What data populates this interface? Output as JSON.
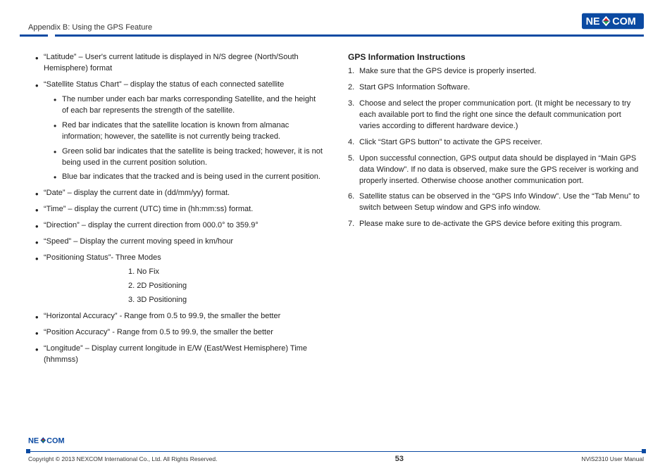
{
  "header": {
    "breadcrumb": "Appendix B: Using the GPS Feature",
    "brand": "NEXCOM"
  },
  "left": {
    "items": [
      {
        "text": "“Latitude” – User's current latitude is displayed in N/S degree (North/South Hemisphere) format"
      },
      {
        "text": "“Satellite Status Chart” – display the status of each connected satellite",
        "sub": [
          "The number under each bar marks corresponding Satellite, and the height of each bar represents the strength of the satellite.",
          "Red bar indicates that the satellite location is known from almanac information; however, the satellite is not currently being tracked.",
          "Green solid bar indicates that the satellite is being tracked; however, it is not being used in the current position solution.",
          "Blue bar indicates that the tracked and is being used in the current position."
        ]
      },
      {
        "text": "“Date” – display the current date in (dd/mm/yy) format."
      },
      {
        "text": "“Time” – display the current (UTC) time in (hh:mm:ss) format."
      },
      {
        "text": "“Direction” – display the current direction from 000.0° to 359.9°"
      },
      {
        "text": "“Speed” – Display the current moving speed in km/hour"
      },
      {
        "text": "“Positioning Status”- Three Modes",
        "modes": [
          "1. No Fix",
          "2. 2D Positioning",
          "3. 3D Positioning"
        ]
      },
      {
        "text": "“Horizontal Accuracy” - Range from 0.5 to 99.9, the smaller the better"
      },
      {
        "text": "“Position Accuracy” - Range from 0.5 to 99.9, the smaller the better"
      },
      {
        "text": "“Longitude” – Display current longitude in E/W (East/West Hemisphere) Time (hhmmss)"
      }
    ]
  },
  "right": {
    "heading": "GPS Information Instructions",
    "steps": [
      "Make sure that the GPS device is properly inserted.",
      "Start GPS Information Software.",
      "Choose and select the proper communication port. (It might be necessary to try each available port to find the right one since the default communication port varies according to different hardware device.)",
      "Click “Start GPS button” to activate the GPS receiver.",
      "Upon successful connection, GPS output data should be displayed in “Main GPS data Window”. If no data is observed, make sure the GPS receiver is working and properly inserted. Otherwise choose another communication port.",
      "Satellite status can be observed in the “GPS Info Window”. Use the “Tab Menu” to switch between Setup window and GPS info window.",
      "Please make sure to de-activate the GPS device before exiting this program."
    ]
  },
  "footer": {
    "copyright": "Copyright © 2013 NEXCOM International Co., Ltd. All Rights Reserved.",
    "page": "53",
    "manual": "NViS2310 User Manual"
  }
}
